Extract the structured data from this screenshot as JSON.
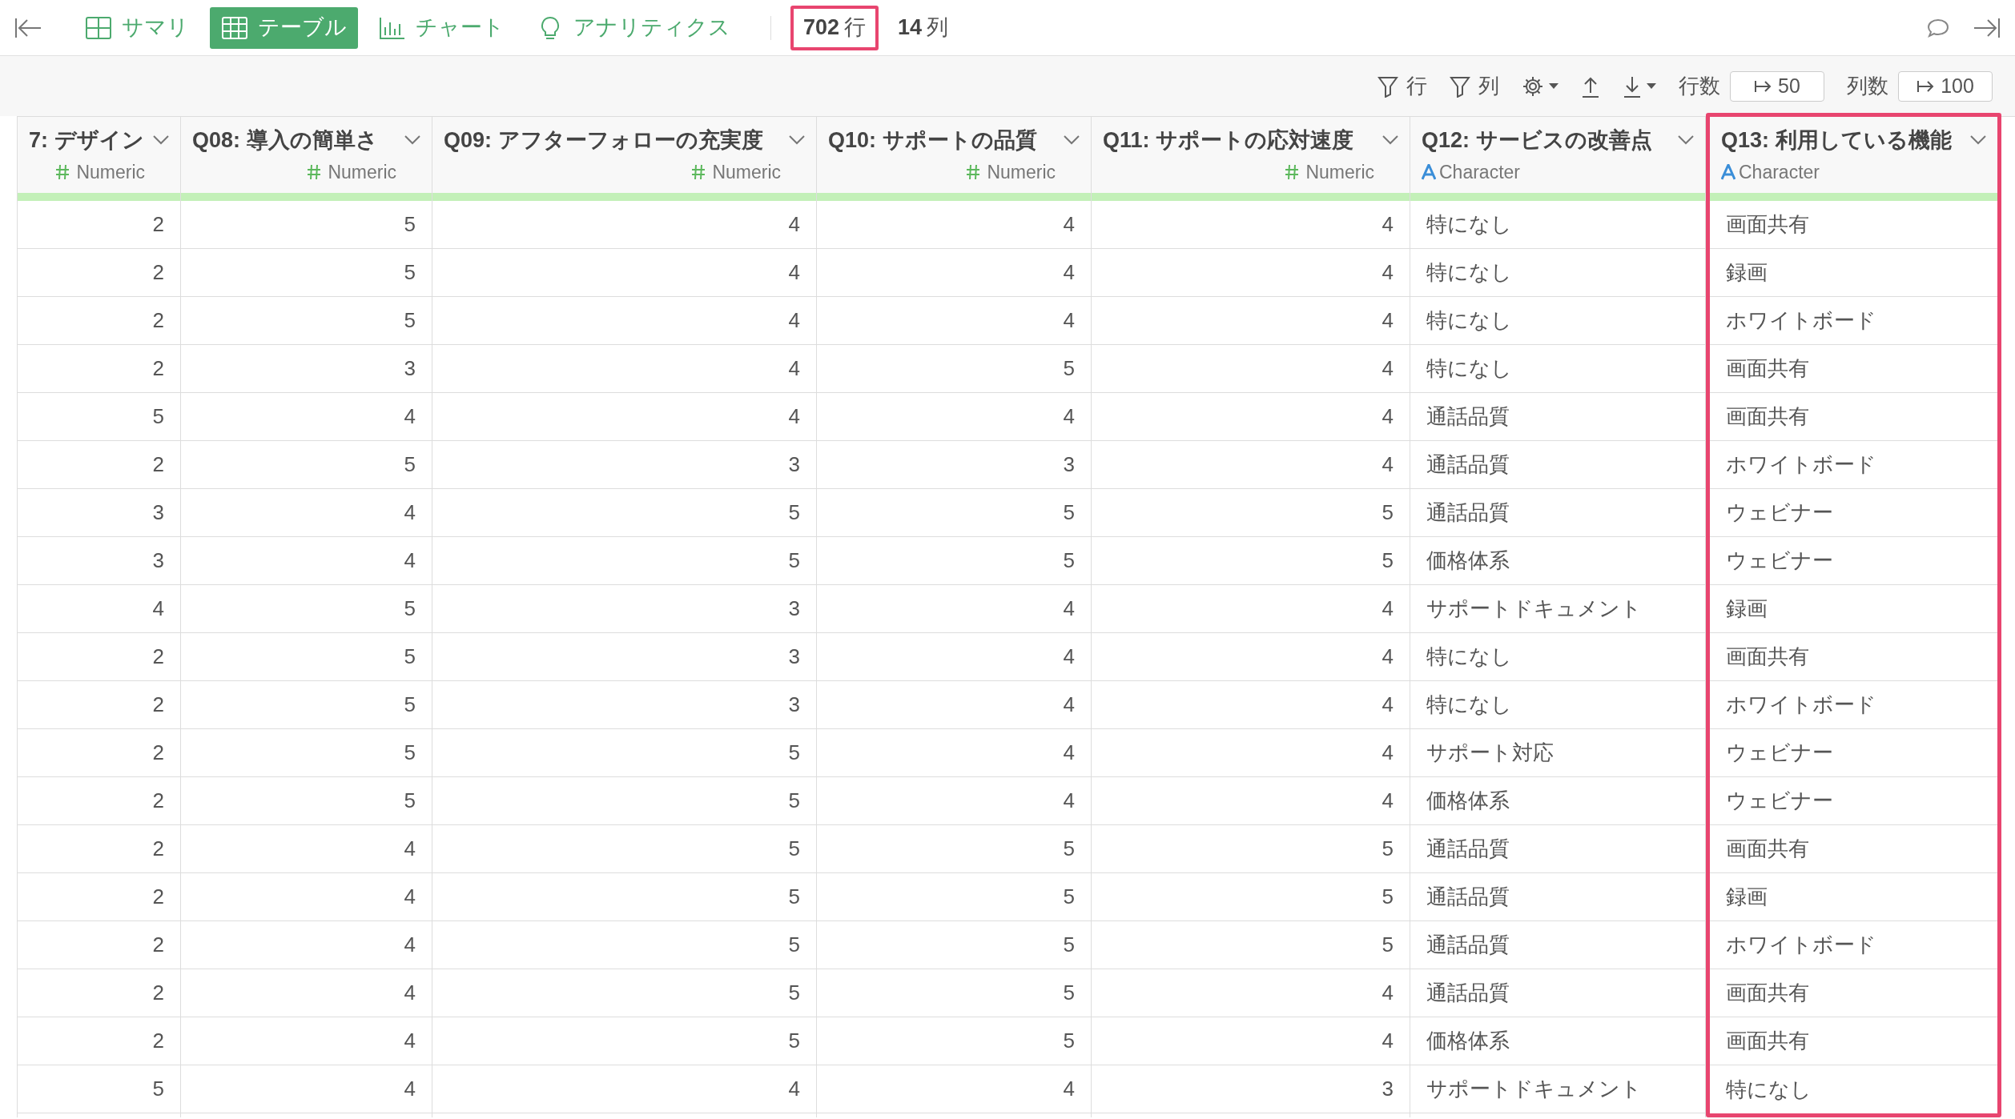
{
  "tabs": [
    {
      "kind": "summary",
      "label": "サマリ",
      "selected": false
    },
    {
      "kind": "table",
      "label": "テーブル",
      "selected": true
    },
    {
      "kind": "chart",
      "label": "チャート",
      "selected": false
    },
    {
      "kind": "analytics",
      "label": "アナリティクス",
      "selected": false
    }
  ],
  "counts": [
    {
      "value": "702",
      "unit": "行",
      "highlighted": true
    },
    {
      "value": "14",
      "unit": "列",
      "highlighted": false
    }
  ],
  "toolbar": {
    "row_filter": "行",
    "column_filter": "列",
    "row_count_label": "行数",
    "row_count": "50",
    "column_count_label": "列数",
    "column_count": "100"
  },
  "columns": [
    {
      "name": "7: デザイン",
      "type": "Numeric",
      "highlighted": false
    },
    {
      "name": "Q08: 導入の簡単さ",
      "type": "Numeric",
      "highlighted": false
    },
    {
      "name": "Q09: アフターフォローの充実度",
      "type": "Numeric",
      "highlighted": false
    },
    {
      "name": "Q10: サポートの品質",
      "type": "Numeric",
      "highlighted": false
    },
    {
      "name": "Q11: サポートの応対速度",
      "type": "Numeric",
      "highlighted": false
    },
    {
      "name": "Q12: サービスの改善点",
      "type": "Character",
      "highlighted": false
    },
    {
      "name": "Q13: 利用している機能",
      "type": "Character",
      "highlighted": true
    }
  ],
  "rows": [
    [
      "2",
      "5",
      "4",
      "4",
      "4",
      "特になし",
      "画面共有"
    ],
    [
      "2",
      "5",
      "4",
      "4",
      "4",
      "特になし",
      "録画"
    ],
    [
      "2",
      "5",
      "4",
      "4",
      "4",
      "特になし",
      "ホワイトボード"
    ],
    [
      "2",
      "3",
      "4",
      "5",
      "4",
      "特になし",
      "画面共有"
    ],
    [
      "5",
      "4",
      "4",
      "4",
      "4",
      "通話品質",
      "画面共有"
    ],
    [
      "2",
      "5",
      "3",
      "3",
      "4",
      "通話品質",
      "ホワイトボード"
    ],
    [
      "3",
      "4",
      "5",
      "5",
      "5",
      "通話品質",
      "ウェビナー"
    ],
    [
      "3",
      "4",
      "5",
      "5",
      "5",
      "価格体系",
      "ウェビナー"
    ],
    [
      "4",
      "5",
      "3",
      "4",
      "4",
      "サポートドキュメント",
      "録画"
    ],
    [
      "2",
      "5",
      "3",
      "4",
      "4",
      "特になし",
      "画面共有"
    ],
    [
      "2",
      "5",
      "3",
      "4",
      "4",
      "特になし",
      "ホワイトボード"
    ],
    [
      "2",
      "5",
      "5",
      "4",
      "4",
      "サポート対応",
      "ウェビナー"
    ],
    [
      "2",
      "5",
      "5",
      "4",
      "4",
      "価格体系",
      "ウェビナー"
    ],
    [
      "2",
      "4",
      "5",
      "5",
      "5",
      "通話品質",
      "画面共有"
    ],
    [
      "2",
      "4",
      "5",
      "5",
      "5",
      "通話品質",
      "録画"
    ],
    [
      "2",
      "4",
      "5",
      "5",
      "5",
      "通話品質",
      "ホワイトボード"
    ],
    [
      "2",
      "4",
      "5",
      "5",
      "4",
      "通話品質",
      "画面共有"
    ],
    [
      "2",
      "4",
      "5",
      "5",
      "4",
      "価格体系",
      "画面共有"
    ],
    [
      "5",
      "4",
      "4",
      "4",
      "3",
      "サポートドキュメント",
      "特になし"
    ]
  ]
}
